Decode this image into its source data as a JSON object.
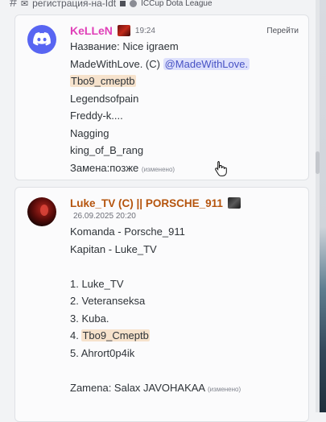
{
  "channel_bar": {
    "hash": "#",
    "channel_name": "регистрация-на-Idt",
    "league": "ICCup Dota League"
  },
  "messages": [
    {
      "author": "KeLLeN",
      "time": "19:24",
      "goto_label": "Перейти",
      "lines": {
        "l1": "Название: Nice igraem",
        "l2_prefix": "MadeWithLove. (C) ",
        "l2_mention": "@MadeWithLove.",
        "l3": "Tbo9_cmeptb",
        "l4": "Legendsofpain",
        "l5": "Freddy-k....",
        "l6": "Nagging",
        "l7": "king_of_B_rang",
        "l8": "Замена:позже",
        "edited": "(изменено)"
      }
    },
    {
      "author": "Luke_TV (C) || PORSCHE_911",
      "date": "26.09.2025 20:20",
      "lines": {
        "l1": "Komanda - Porsche_911",
        "l2": "Kapitan - Luke_TV",
        "l3": "1. Luke_TV",
        "l4": "2. Veteranseksa",
        "l5": "3. Kuba.",
        "l6_prefix": "4. ",
        "l6_name": "Tbo9_Cmeptb",
        "l7": "5. Ahrort0p4ik",
        "l8": "Zamena: Salax JAVOHAKAA",
        "edited": "(изменено)"
      }
    }
  ],
  "colors": {
    "accent_blurple": "#5865f2",
    "author1": "#e040b8",
    "author2": "#b5540d",
    "mention_bg": "#dde0fc",
    "highlight_bg": "#f6e2cc"
  },
  "icons": {
    "avatar1": "discord-logo-icon",
    "cursor": "hand-pointer-icon",
    "channel": "envelope-icon"
  }
}
